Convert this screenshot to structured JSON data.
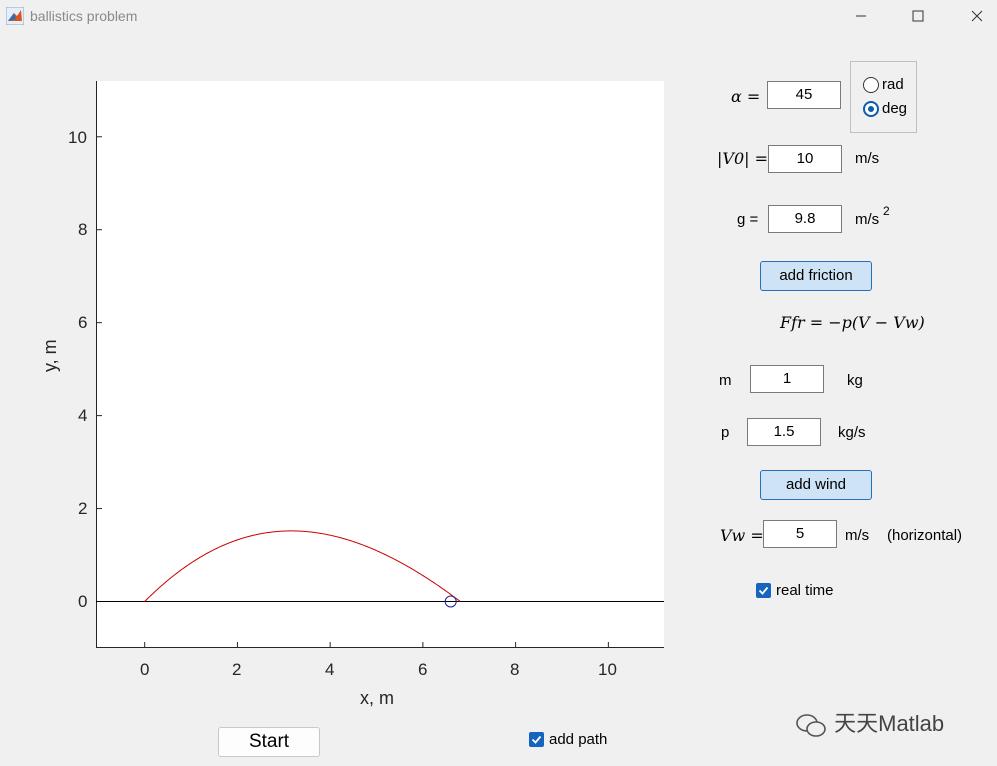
{
  "window": {
    "title": "ballistics problem",
    "controls": [
      "minimize",
      "maximize",
      "close"
    ]
  },
  "plot": {
    "xlabel": "x, m",
    "ylabel": "y, m",
    "x_ticks": [
      "0",
      "2",
      "4",
      "6",
      "8",
      "10"
    ],
    "y_ticks": [
      "0",
      "2",
      "4",
      "6",
      "8",
      "10"
    ],
    "xlim": [
      -1.05,
      11.2
    ],
    "ylim": [
      -1.0,
      11.2
    ],
    "trajectory_color": "#cc0000",
    "marker_color": "#1f1f9e",
    "ground_line_y": 0,
    "marker_position": {
      "x": 6.6,
      "y": 0
    }
  },
  "controls": {
    "alpha": {
      "symbol": "α =",
      "value": "45"
    },
    "angle_units": {
      "options": [
        "rad",
        "deg"
      ],
      "selected": "deg"
    },
    "v0": {
      "symbol": "|V0| =",
      "value": "10",
      "unit": "m/s"
    },
    "g": {
      "label": "g =",
      "value": "9.8",
      "unit": "m/s",
      "unit_exp": "2"
    },
    "add_friction_label": "add friction",
    "friction_formula": "Ffr = −p(V − Vw)",
    "m": {
      "label": "m",
      "value": "1",
      "unit": "kg"
    },
    "p": {
      "label": "p",
      "value": "1.5",
      "unit": "kg/s"
    },
    "add_wind_label": "add wind",
    "vw": {
      "symbol": "Vw =",
      "value": "5",
      "unit": "m/s",
      "note": "(horizontal)"
    },
    "real_time": {
      "label": "real time",
      "checked": true
    },
    "add_path": {
      "label": "add path",
      "checked": true
    },
    "start_label": "Start"
  },
  "watermark": "天天Matlab"
}
